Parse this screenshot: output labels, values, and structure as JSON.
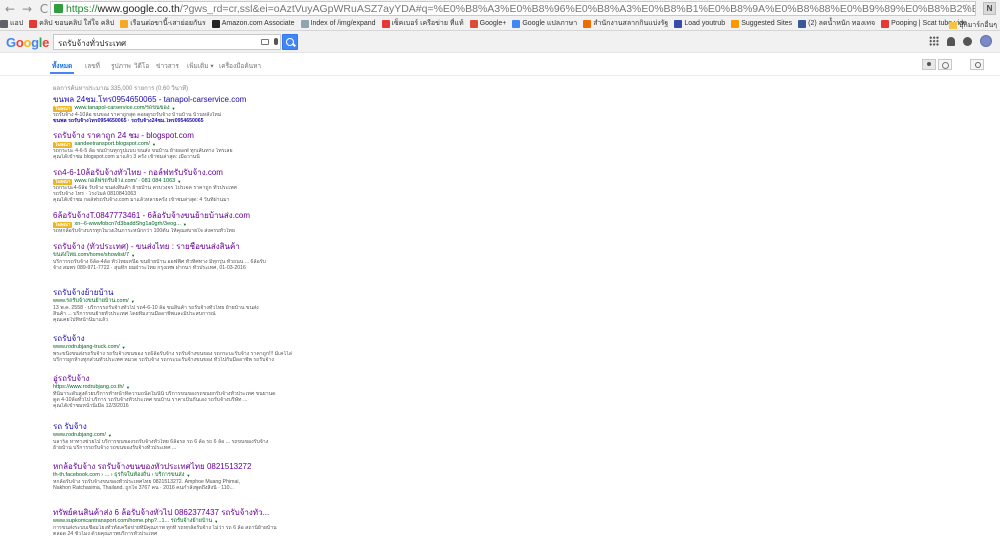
{
  "browser": {
    "back": "←",
    "forward": "→",
    "reload": "C",
    "url_scheme": "https://",
    "url_host": "www.google.co.th",
    "url_path": "/?gws_rd=cr,ssl&ei=oAztVuyAGpWRuASZ7ayYDA#q=%E0%B8%A3%E0%B8%96%E0%B8%A3%E0%B8%B1%E0%B8%9A%E0%B8%88%E0%B9%89%E0%B8%B2%E0%B8%87%E0%B8%97%E0%B8%B1",
    "extension_label": "N",
    "star": "☆",
    "bookmarks": [
      {
        "label": "แอป",
        "color": "#5f6368"
      },
      {
        "label": "คลิป ขอนคลิป ใส่ใจ คลิป",
        "color": "#e53935"
      },
      {
        "label": "เรือนต่อขานี้-เสาย่อยกันร",
        "color": "#f9a825"
      },
      {
        "label": "Amazon.com Associate",
        "color": "#222222"
      },
      {
        "label": "Index of /img/expand",
        "color": "#90a4ae"
      },
      {
        "label": "เซ็คเบอร์ เครือข่าย ที่แท้",
        "color": "#e53935"
      },
      {
        "label": "Google+",
        "color": "#dd4b39"
      },
      {
        "label": "Google แปลภาษา",
        "color": "#4285f4"
      },
      {
        "label": "สำนักงานสลากกินแบ่งรัฐ",
        "color": "#ef6c00"
      },
      {
        "label": "Load youtrub",
        "color": "#3949ab"
      },
      {
        "label": "Suggested Sites",
        "color": "#ff9800"
      },
      {
        "label": "(2) ลดน้ำหนัก ทองเทจ",
        "color": "#3b5998"
      },
      {
        "label": "Pooping | Scat tube vide",
        "color": "#e53935"
      }
    ],
    "bookmarks_other": "บุ๊กมาร์กอื่นๆ"
  },
  "google": {
    "logo": [
      {
        "ch": "G",
        "color": "#4285f4"
      },
      {
        "ch": "o",
        "color": "#ea4335"
      },
      {
        "ch": "o",
        "color": "#fbbc05"
      },
      {
        "ch": "g",
        "color": "#4285f4"
      },
      {
        "ch": "l",
        "color": "#34a853"
      },
      {
        "ch": "e",
        "color": "#ea4335"
      }
    ],
    "query": "รถรับจ้างทั่วประเทศ",
    "tabs": [
      "ทั้งหมด",
      "เลขที่",
      "รูปภาพ",
      "วิดีโอ",
      "ข่าวสาร",
      "เพิ่มเติม ▾",
      "เครื่องมือค้นหา"
    ],
    "stats": "ผลการค้นหาประมาณ 335,000 รายการ (0.60 วินาที)"
  },
  "results": [
    {
      "title": "ขนพล 24ชม.โทร0954650065 - tanapol-carservice.com",
      "visited": false,
      "ad": true,
      "url": "www.tanapol-carservice.com/รถขนของ",
      "snippet": [
        {
          "t": "รถรับจ้าง 4-10ล้อ ขนของ ราคาถูกสุด คอยดูรถรับจ้าง บ้านบ้าน บ้านหลังใหม่",
          "c": ""
        },
        {
          "t": "ขนพล รถรับจ้างโทร0954650065 · รถรับจ้าง24ชม.โทร0954650065",
          "c": "darkb"
        }
      ]
    },
    {
      "title": "รถรับจ้าง ราคาถูก 24 ชม - blogspot.com",
      "visited": true,
      "ad": true,
      "url": "sandeetransport.blogspot.com/",
      "snippet": [
        {
          "t": "รถกระบะ 4-6-5 ล้อ ขนบ้านทุกรูปแบบ ขนส่ง ขนบ้าน ย้ายออฟ ทุกเส้นทาง โทรเลย",
          "c": ""
        },
        {
          "t": "คุณได้เข้าชม blogspot.com มาแล้ว 3 ครั้ง เข้าชมล่าสุด: เมื่อวานนี้",
          "c": ""
        }
      ]
    },
    {
      "title": "รถ4-6-10ล้อรับจ้างทั่วไทย - กอล์ฟทรับรับจ้าง.com",
      "visited": true,
      "ad": true,
      "url": "www.กอล์ฟรถรับจ้าง.com/  ·  081 084 1063",
      "snippet": [
        {
          "t": "รถกระบะ4-6ล้อ รับจ้าง ขนส่งสินค้า ย้ายบ้าน ครบวงจร โปรเจค ราคาถูก ทั่วประเทศ",
          "c": ""
        },
        {
          "t": "รถรับจ้าง โทร · โรงไมล์ 0810841063",
          "c": ""
        },
        {
          "t": "คุณได้เข้าชม กอล์ฟรถรับจ้าง.com มาแล้วหลายครั้ง เข้าชมล่าสุด: 4 วันที่ผ่านมา",
          "c": ""
        }
      ]
    },
    {
      "title": "6ล้อรับจ้างT.0847773461 - 6ล้อรับจ้างขนย้ายบ้านส่ง.com",
      "visited": true,
      "ad": true,
      "url": "xn--6-wwwfobcn7d3baddShg1a0grh/3eog...",
      "snippet": [
        {
          "t": "รถหกล้อรับจ้างบรรทุกในวงเงินภาระหนักกว่า 100ตัน ให้คุณสบายใจ ส่งครบทั่วไทย",
          "c": ""
        }
      ]
    },
    {
      "title": "รถรับจ้าง (ทั่วประเทศ) - ขนส่งไทย : รายชื่อขนส่งสินค้า",
      "visited": true,
      "ad": false,
      "url": "ขนส่งไทย.com/home/showlist/7",
      "snippet": [
        {
          "t": "บริการรถรับจ้าง 6ล้อ-4ล้อ ทั่วไทยเหนือ ขนย้ายบ้าน ออฟฟิศ ทั่วทิศทาง มีทุกรุ่น ทั่วถนน ... 6ล้อรับ",
          "c": ""
        },
        {
          "t": "จ้าง สมพร 089-971-7722 · สุนทีก ยมฝาระไทย กรุงเทพ ฝากนา ทั่วประเทศ, 01-03-2016",
          "c": ""
        }
      ]
    },
    {
      "title": "รถรับจ้างย้ายบ้าน",
      "visited": false,
      "ad": false,
      "url": "www.รถรับจ้างขนย้ายบ้าน.com/",
      "snippet": [
        {
          "t": "13 พ.ค. 2558 · บริการรถรับจ้างทั่วไป รถ4-6-10 ล้อ ขนสินค้า รถรับจ้างทั่วไทย ย้ายบ้าน ขนส่ง",
          "c": ""
        },
        {
          "t": "สินค้า ... บริการขนย้ายทั่วประเทศ โดยทีมงานมืออาชีพและมีประสบการณ์",
          "c": ""
        },
        {
          "t": "คุณเคยไปที่หน้านี้มาแล้ว",
          "c": ""
        }
      ]
    },
    {
      "title": "รถรับจ้าง",
      "visited": false,
      "ad": false,
      "url": "www.rodrubjang-truck.com/",
      "snippet": [
        {
          "t": "พระขนิ่งขนส่งรถรับจ้าง รถรับจ้างขนของ รถ6ล้อรับจ้าง รถรับจ้างขนของ รถกระบะรับจ้าง ราคาถูก!!! มีเคโไล่",
          "c": ""
        },
        {
          "t": "บริการผูกห้างทุกส่วนทั่วประเทศ หมวด รถรับจ้าง รถกระบะรับจ้างขนของ ทั่วไปกับมืออาชีพ รถรับจ้าง",
          "c": ""
        }
      ]
    },
    {
      "title": "อู่รถรับจ้าง",
      "visited": true,
      "ad": false,
      "url": "https://www.rodrubjang.co.th/",
      "snippet": [
        {
          "t": "ที่นี่มาระดับสูงด้วยบริการทำหน้าที่ความถนัดในนี้นี้ บริการขนของรถขนยกรับจ้างทั่วประเทศ ขนยานด",
          "c": ""
        },
        {
          "t": "ดูด 4-10ล้อทั่วไป บริการ รถรับจ้างทั่วประเทศ ขนบ้าน ราคาเป็นกันเอง รถรับจ้างบริษัท ...",
          "c": ""
        },
        {
          "t": "คุณได้เข้าชมหน้านี้เมื่อ 12/3/2016",
          "c": ""
        }
      ]
    },
    {
      "title": "รถ รับจ้าง",
      "visited": false,
      "ad": false,
      "url": "www.rodrubjang.com/",
      "snippet": [
        {
          "t": "บลาร็อ หาทางช่วยไป บริการขนของรถรับจ้างทั่วไทย 6ล้อรถ รถ 6 ล้อ รถ 6 ล้อ ... รถขนของรับจ้าง",
          "c": ""
        },
        {
          "t": "ย้ายบ้าน บริการรถรับจ้าง รถขนของรับจ้างทั่วประเทศ ...",
          "c": ""
        }
      ]
    },
    {
      "title": "หกล้อรับจ้าง รถรับจ้างขนของทั่วประเทศไทย 0821513272",
      "visited": true,
      "ad": false,
      "url": "th-th.facebook.com › ... › ธุรกิจในท้องถิ่น › บริการขนส่ง",
      "snippet": [
        {
          "t": "หกล้อรับจ้าง รถรับจ้างขนของทั่วประเทศไทย 0821513272. Amphoe Muang Phimai,",
          "c": ""
        },
        {
          "t": "Nakhon Ratchasima, Thailand. ถูกใจ 3767 คน · 2016 คนกำลังพูดถึงสิ่งนี้ · 110...",
          "c": ""
        }
      ]
    },
    {
      "title": "ทรัพย์คนสินค้าส่ง 6 ล้อรับจ้างทั่วไป 0862377437 รถรับจ้างทั่ว...",
      "visited": true,
      "ad": false,
      "url": "www.supkomcantransport.com/home.php?...1... รถรับจ้างย้ายบ้าน",
      "snippet": [
        {
          "t": "การขนส่งระบบเชื่อมโยงทั่วทั้งเครือข่ายที่มีคุณภาพ ทุกที่ รถหกล้อรับจ้าง ไม่ว่า รถ 6 ล้อ สถานีย้ายบ้าน",
          "c": ""
        },
        {
          "t": "ตลอด 24 ชั่วโมง ด้วยคุณภาพบริการทั่วประเทศ",
          "c": ""
        }
      ]
    }
  ]
}
